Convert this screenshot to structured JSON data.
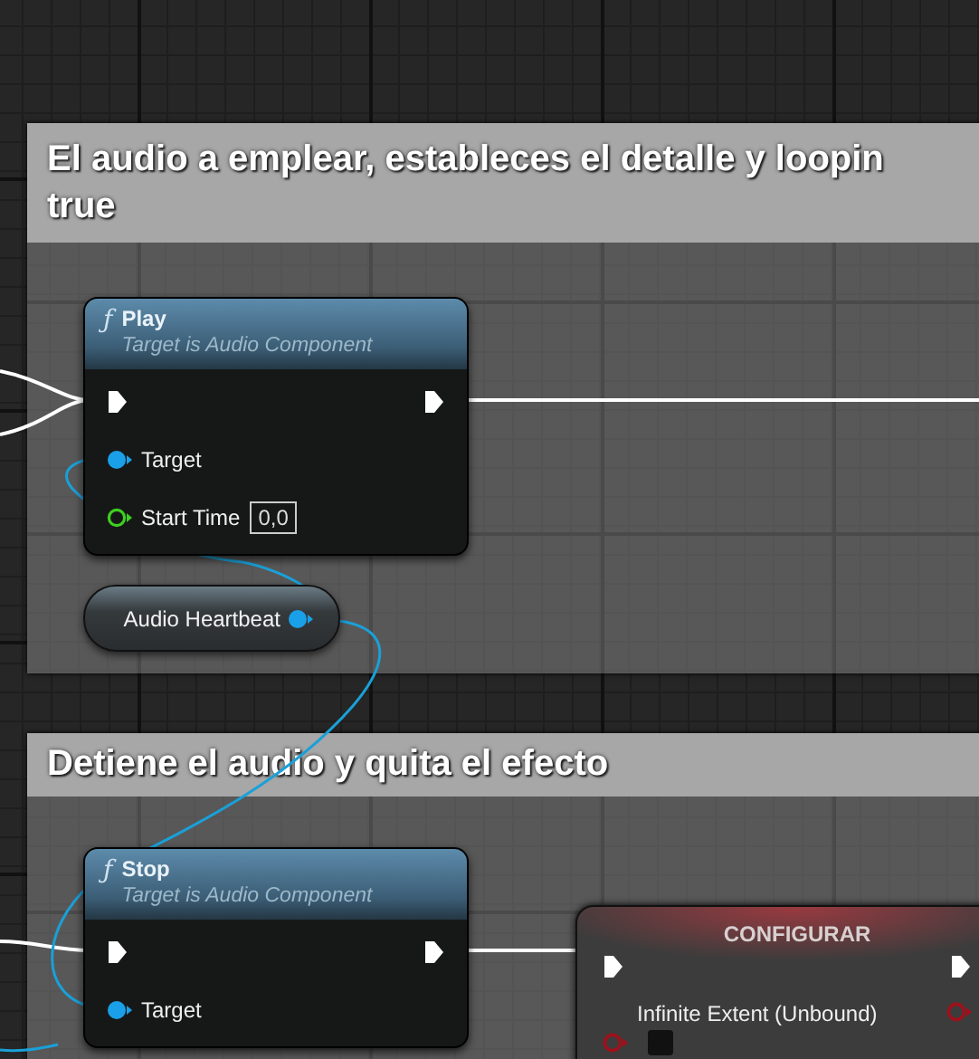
{
  "comments": [
    {
      "title_lines": [
        "El audio a emplear, estableces el detalle y loopin",
        "true"
      ]
    },
    {
      "title_lines": [
        "Detiene el audio y quita el efecto"
      ]
    }
  ],
  "nodes": [
    {
      "kind": "function",
      "icon_glyph": "ƒ",
      "title": "Play",
      "subtitle": "Target is Audio Component",
      "rows": [
        {
          "in": {
            "kind": "exec"
          },
          "out": {
            "kind": "exec"
          }
        },
        {
          "in": {
            "kind": "object",
            "label": "Target"
          }
        },
        {
          "in": {
            "kind": "float",
            "label": "Start Time",
            "value": "0,0"
          }
        }
      ]
    },
    {
      "kind": "variable",
      "label": "Audio Heartbeat"
    },
    {
      "kind": "function",
      "icon_glyph": "ƒ",
      "title": "Stop",
      "subtitle": "Target is Audio Component",
      "rows": [
        {
          "in": {
            "kind": "exec"
          },
          "out": {
            "kind": "exec"
          }
        },
        {
          "in": {
            "kind": "object",
            "label": "Target"
          }
        }
      ]
    },
    {
      "kind": "setter",
      "title": "CONFIGURAR",
      "rows": [
        {
          "in": {
            "kind": "exec"
          },
          "out": {
            "kind": "exec"
          }
        },
        {
          "in": {
            "kind": "bool",
            "label": "Infinite Extent (Unbound)",
            "checked": false
          },
          "out": {
            "kind": "bool"
          }
        }
      ]
    }
  ]
}
